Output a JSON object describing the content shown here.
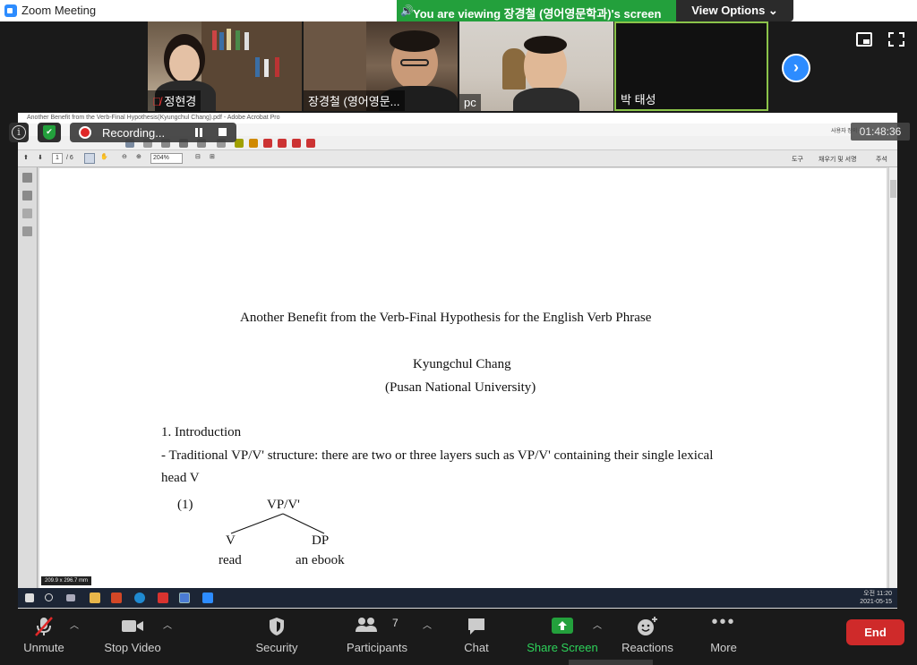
{
  "window": {
    "title": "Zoom Meeting"
  },
  "banner": {
    "text": "You are viewing 장경철 (영어영문학과)'s screen",
    "view_options": "View Options ⌄"
  },
  "participants_tiles": [
    {
      "name": "정현경",
      "muted": true
    },
    {
      "name": "장경철 (영어영문..."
    },
    {
      "name": "pc"
    },
    {
      "name": "박 태성"
    }
  ],
  "recording": {
    "label": "Recording...",
    "timer": "01:48:36"
  },
  "acrobat": {
    "title": "Another Benefit from the Verb-Final Hypothesis(Kyungchul Chang).pdf - Adobe Acrobat Pro",
    "page_current": "1",
    "page_total": "/ 6",
    "zoom": "204%",
    "right_tools": [
      "도구",
      "채우기 및 서명",
      "주석"
    ],
    "sign_in": "사용자 정의 ▾",
    "dimension_tip": "209.9 x 296.7 mm"
  },
  "document": {
    "title": "Another  Benefit  from  the  Verb-Final  Hypothesis  for  the  English  Verb  Phrase",
    "author": "Kyungchul  Chang",
    "affiliation": "(Pusan  National  University)",
    "section": "1.  Introduction",
    "bullet_line1": "-  Traditional  VP/V'  structure:  there  are  two  or  three  layers  such  as  VP/V'  containing  their  single  lexical",
    "bullet_line2": "head  V",
    "example_num": "(1)",
    "tree_root": "VP/V'",
    "tree_left": "V",
    "tree_right": "DP",
    "leaf_left": "read",
    "leaf_right": "an  ebook"
  },
  "taskbar": {
    "time": "오전 11:20",
    "date": "2021-05-15"
  },
  "controls": {
    "unmute": "Unmute",
    "stop_video": "Stop Video",
    "security": "Security",
    "participants": "Participants",
    "participants_count": "7",
    "chat": "Chat",
    "share_screen": "Share Screen",
    "reactions": "Reactions",
    "more": "More",
    "end": "End"
  },
  "colors": {
    "zoom_blue": "#2d8cff",
    "share_green": "#23a03c",
    "end_red": "#cf2a2a"
  }
}
